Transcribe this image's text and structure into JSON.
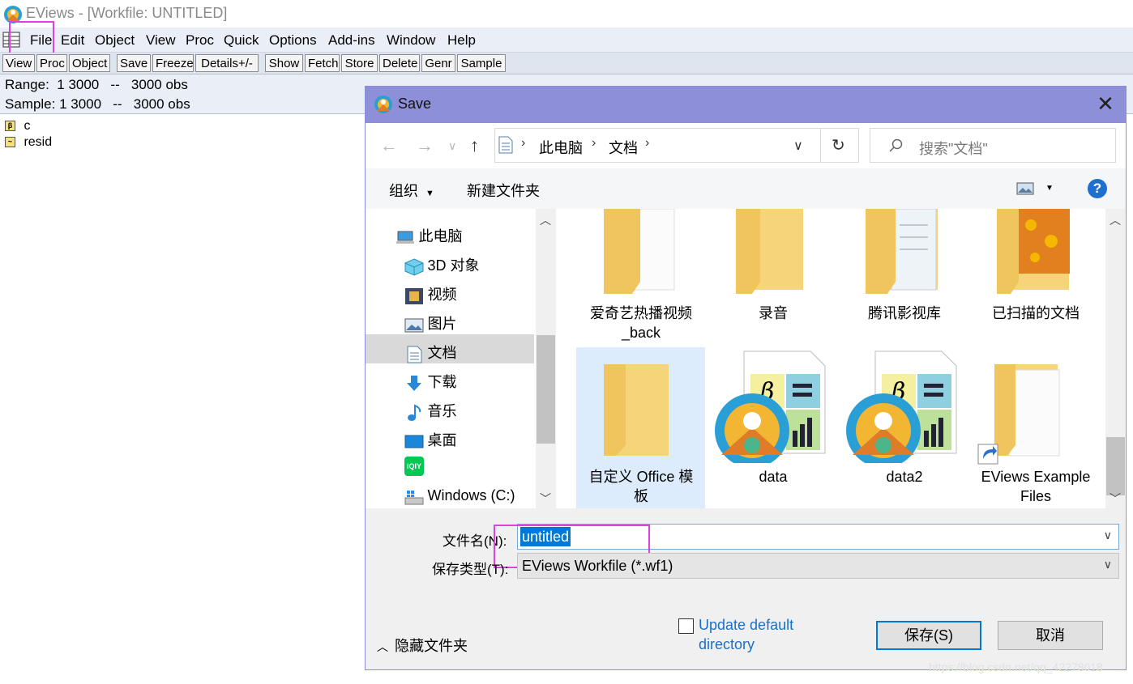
{
  "window": {
    "title": "EViews - [Workfile: UNTITLED]"
  },
  "menu": [
    "File",
    "Edit",
    "Object",
    "View",
    "Proc",
    "Quick",
    "Options",
    "Add-ins",
    "Window",
    "Help"
  ],
  "toolbar": [
    "View",
    "Proc",
    "Object",
    "Save",
    "Freeze",
    "Details+/-",
    "Show",
    "Fetch",
    "Store",
    "Delete",
    "Genr",
    "Sample"
  ],
  "info": {
    "range": "Range:  1 3000   --   3000 obs",
    "sample": "Sample: 1 3000   --   3000 obs"
  },
  "workfile_items": [
    {
      "label": "c",
      "icon": "beta-icon"
    },
    {
      "label": "resid",
      "icon": "series-icon"
    }
  ],
  "dialog": {
    "title": "Save",
    "breadcrumb": [
      "此电脑",
      "文档"
    ],
    "search_placeholder": "搜索\"文档\"",
    "organize": "组织",
    "new_folder": "新建文件夹",
    "nav_items": [
      {
        "label": "此电脑",
        "icon": "computer-icon"
      },
      {
        "label": "3D 对象",
        "icon": "cube-icon"
      },
      {
        "label": "视频",
        "icon": "film-icon"
      },
      {
        "label": "图片",
        "icon": "picture-icon"
      },
      {
        "label": "文档",
        "icon": "document-icon"
      },
      {
        "label": "下载",
        "icon": "download-icon"
      },
      {
        "label": "音乐",
        "icon": "music-icon"
      },
      {
        "label": "桌面",
        "icon": "desktop-icon"
      },
      {
        "label": "",
        "icon": "iqiyi-icon"
      },
      {
        "label": "Windows (C:)",
        "icon": "drive-icon"
      }
    ],
    "files": [
      {
        "line1": "爱奇艺热播视频",
        "line2": "_back",
        "icon": "folder-icon"
      },
      {
        "line1": "录音",
        "line2": "",
        "icon": "folder-icon"
      },
      {
        "line1": "腾讯影视库",
        "line2": "",
        "icon": "folder-icon"
      },
      {
        "line1": "已扫描的文档",
        "line2": "",
        "icon": "folder-icon"
      },
      {
        "line1": "自定义 Office 模",
        "line2": "板",
        "icon": "folder-icon"
      },
      {
        "line1": "data",
        "line2": "",
        "icon": "eviews-file-icon"
      },
      {
        "line1": "data2",
        "line2": "",
        "icon": "eviews-file-icon"
      },
      {
        "line1": "EViews Example",
        "line2": "Files",
        "icon": "folder-shortcut-icon"
      }
    ],
    "filename_label": "文件名(N):",
    "filename_value": "untitled",
    "filetype_label": "保存类型(T):",
    "filetype_value": "EViews Workfile (*.wf1)",
    "update_default_line1": "Update default",
    "update_default_line2": "directory",
    "hide_folders": "隐藏文件夹",
    "save_button": "保存(S)",
    "cancel_button": "取消"
  },
  "watermark": "https://blog.csdn.net/qq_42278018",
  "colors": {
    "highlight": "#e040e0",
    "dialog_title": "#8d8fd9",
    "selection": "#0078d7"
  }
}
